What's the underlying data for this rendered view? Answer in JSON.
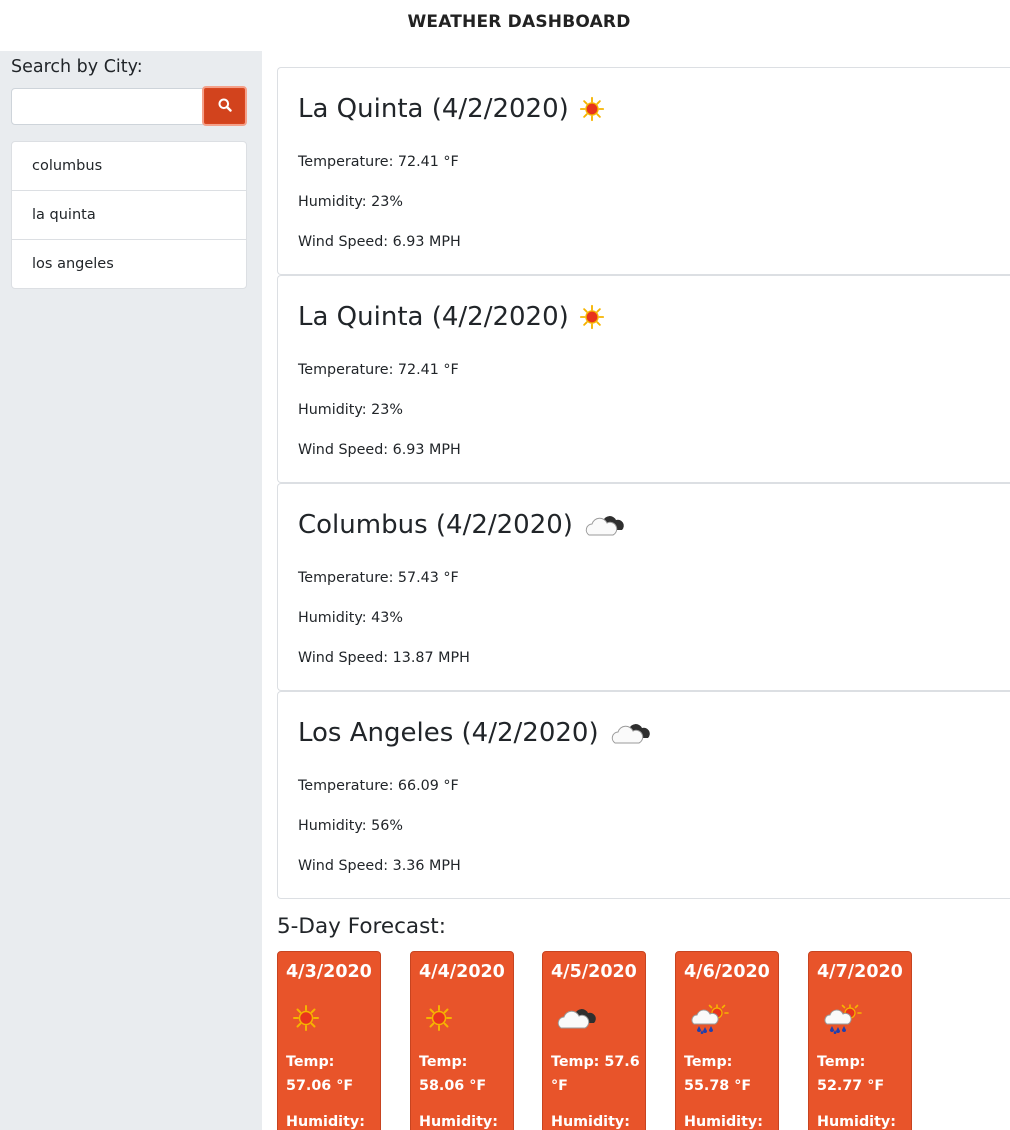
{
  "app": {
    "title": "WEATHER DASHBOARD"
  },
  "search": {
    "label": "Search by City:",
    "value": "",
    "placeholder": "",
    "button_icon": "search-icon"
  },
  "history": [
    "columbus",
    "la quinta",
    "los angeles"
  ],
  "current": [
    {
      "title": "La Quinta (4/2/2020)",
      "icon": "sun-icon",
      "temp": "Temperature: 72.41 °F",
      "humidity": "Humidity: 23%",
      "wind": "Wind Speed: 6.93 MPH"
    },
    {
      "title": "La Quinta (4/2/2020)",
      "icon": "sun-icon",
      "temp": "Temperature: 72.41 °F",
      "humidity": "Humidity: 23%",
      "wind": "Wind Speed: 6.93 MPH"
    },
    {
      "title": "Columbus (4/2/2020)",
      "icon": "cloud-icon",
      "temp": "Temperature: 57.43 °F",
      "humidity": "Humidity: 43%",
      "wind": "Wind Speed: 13.87 MPH"
    },
    {
      "title": "Los Angeles (4/2/2020)",
      "icon": "cloud-icon",
      "temp": "Temperature: 66.09 °F",
      "humidity": "Humidity: 56%",
      "wind": "Wind Speed: 3.36 MPH"
    }
  ],
  "forecast": {
    "title": "5-Day Forecast:",
    "days": [
      {
        "date": "4/3/2020",
        "icon": "sun-icon",
        "temp": "Temp: 57.06 °F",
        "humidity": "Humidity:"
      },
      {
        "date": "4/4/2020",
        "icon": "sun-icon",
        "temp": "Temp: 58.06 °F",
        "humidity": "Humidity:"
      },
      {
        "date": "4/5/2020",
        "icon": "cloud-icon",
        "temp": "Temp: 57.6 °F",
        "humidity": "Humidity:"
      },
      {
        "date": "4/6/2020",
        "icon": "rain-sun-icon",
        "temp": "Temp: 55.78 °F",
        "humidity": "Humidity:"
      },
      {
        "date": "4/7/2020",
        "icon": "rain-sun-icon",
        "temp": "Temp: 52.77 °F",
        "humidity": "Humidity:"
      }
    ]
  },
  "colors": {
    "accent": "#e8542a",
    "search_button": "#d2431d",
    "sidebar_bg": "#e9ecef"
  }
}
